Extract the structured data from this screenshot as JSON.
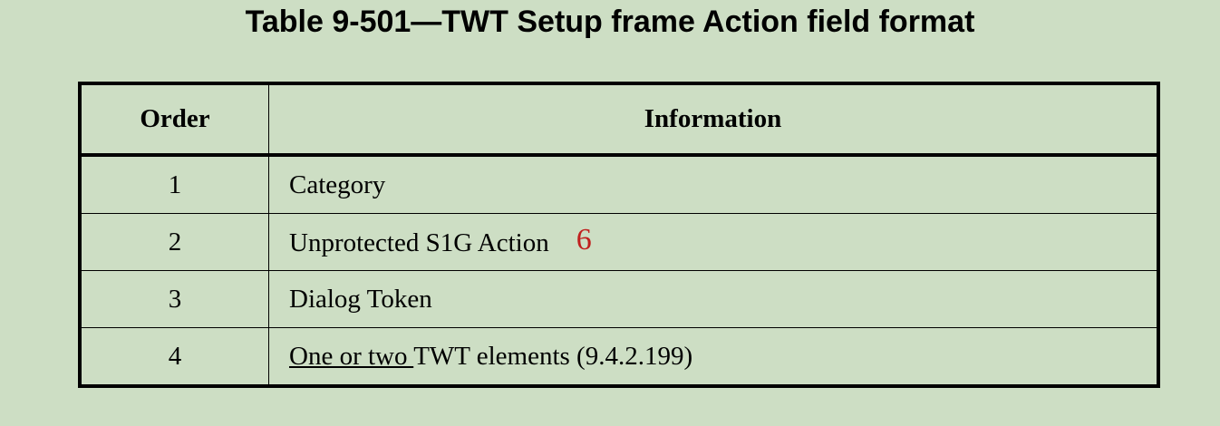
{
  "title": "Table 9-501—TWT Setup frame Action field format",
  "table": {
    "headers": [
      "Order",
      "Information"
    ],
    "rows": [
      {
        "order": "1",
        "info": "Category"
      },
      {
        "order": "2",
        "info": "Unprotected S1G Action",
        "annotation": "6"
      },
      {
        "order": "3",
        "info": "Dialog Token"
      },
      {
        "order": "4",
        "info_underlined": "One or two ",
        "info": "TWT elements (9.4.2.199)"
      }
    ]
  },
  "colors": {
    "background": "#cddec4",
    "annotation": "#c0201e"
  }
}
